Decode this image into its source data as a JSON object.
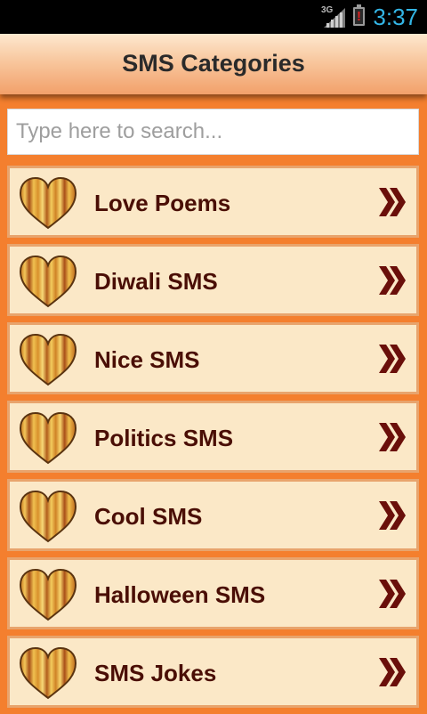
{
  "status_bar": {
    "network": "3G",
    "time": "3:37"
  },
  "header": {
    "title": "SMS Categories"
  },
  "search": {
    "placeholder": "Type here to search...",
    "value": ""
  },
  "categories": [
    {
      "label": "Love Poems"
    },
    {
      "label": "Diwali SMS"
    },
    {
      "label": "Nice SMS"
    },
    {
      "label": "Politics SMS"
    },
    {
      "label": "Cool SMS"
    },
    {
      "label": "Halloween SMS"
    },
    {
      "label": "SMS Jokes"
    }
  ],
  "icons": {
    "row_icon": "heart-icon",
    "row_action": "chevron-right-double-icon"
  },
  "colors": {
    "background": "#f47f2e",
    "row_background": "#fbe8c7",
    "row_border": "#e8a46d",
    "label": "#4a0e05",
    "clock": "#33b5e5"
  }
}
